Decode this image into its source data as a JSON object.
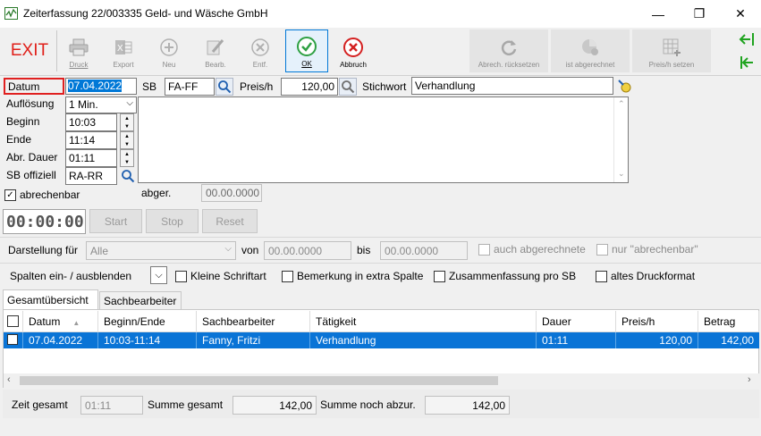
{
  "window": {
    "title": "Zeiterfassung 22/003335 Geld- und Wäsche GmbH",
    "minimize": "—",
    "restore": "❐",
    "close": "✕"
  },
  "toolbar": {
    "exit": "EXIT",
    "druck": "Druck",
    "export": "Export",
    "neu": "Neu",
    "bearb": "Bearb.",
    "entf": "Entf.",
    "ok": "OK",
    "abbruch": "Abbruch",
    "abrechnung_ruecksetzen": "Abrech. rücksetzen",
    "ist_abgerechnet": "ist abgerechnet",
    "preis_setzen": "Preis/h setzen"
  },
  "form": {
    "datum_label": "Datum",
    "datum": "07.04.2022",
    "aufloesung_label": "Auflösung",
    "aufloesung": "1 Min.",
    "beginn_label": "Beginn",
    "beginn": "10:03",
    "ende_label": "Ende",
    "ende": "11:14",
    "abr_dauer_label": "Abr. Dauer",
    "abr_dauer": "01:11",
    "sb_offiziell_label": "SB offiziell",
    "sb_offiziell": "RA-RR",
    "sb_label": "SB",
    "sb": "FA-FF",
    "preis_label": "Preis/h",
    "preis": "120,00",
    "stichwort_label": "Stichwort",
    "stichwort": "Verhandlung",
    "bemerkung": "",
    "abrechenbar_label": "abrechenbar",
    "abger_label": "abger.",
    "abger": "00.00.0000"
  },
  "timer": {
    "display": "00:00:00",
    "start": "Start",
    "stop": "Stop",
    "reset": "Reset"
  },
  "filter": {
    "darstellung_label": "Darstellung für",
    "darstellung": "Alle",
    "von_label": "von",
    "von": "00.00.0000",
    "bis_label": "bis",
    "bis": "00.00.0000",
    "auch_abgerechnete": "auch abgerechnete",
    "nur_abrechenbar": "nur \"abrechenbar\""
  },
  "options": {
    "spalten": "Spalten ein- / ausblenden",
    "kleine_schrift": "Kleine Schriftart",
    "bemerkung_spalte": "Bemerkung in extra Spalte",
    "zusammenfassung": "Zusammenfassung pro SB",
    "altes_druckformat": "altes Druckformat"
  },
  "tabs": [
    {
      "label": "Gesamtübersicht"
    },
    {
      "label": "Sachbearbeiter"
    }
  ],
  "table": {
    "columns": [
      "Datum",
      "Beginn/Ende",
      "Sachbearbeiter",
      "Tätigkeit",
      "Dauer",
      "Preis/h",
      "Betrag"
    ],
    "sort_indicator": "▲",
    "rows": [
      [
        "07.04.2022",
        "10:03-11:14",
        "Fanny, Fritzi",
        "Verhandlung",
        "01:11",
        "120,00",
        "142,00"
      ]
    ]
  },
  "summary": {
    "zeit_gesamt_label": "Zeit gesamt",
    "zeit_gesamt": "01:11",
    "summe_gesamt_label": "Summe gesamt",
    "summe_gesamt": "142,00",
    "summe_noch_label": "Summe noch abzur.",
    "summe_noch": "142,00"
  },
  "colors": {
    "accent": "#0078d7",
    "selection": "#0a74d6",
    "exit_red": "#e0201a",
    "ok_green": "#2ea043",
    "cancel_red": "#d42020",
    "nav_green": "#1fa31f"
  }
}
